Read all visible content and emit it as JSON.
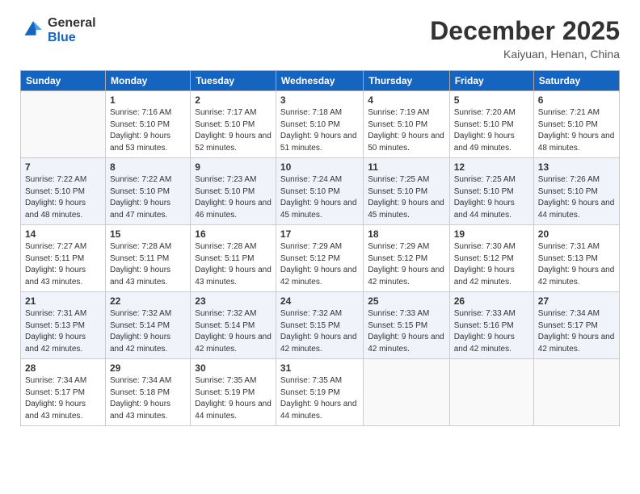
{
  "header": {
    "logo_general": "General",
    "logo_blue": "Blue",
    "month": "December 2025",
    "location": "Kaiyuan, Henan, China"
  },
  "weekdays": [
    "Sunday",
    "Monday",
    "Tuesday",
    "Wednesday",
    "Thursday",
    "Friday",
    "Saturday"
  ],
  "weeks": [
    [
      {
        "day": null
      },
      {
        "day": 1,
        "sunrise": "7:16 AM",
        "sunset": "5:10 PM",
        "daylight": "9 hours and 53 minutes."
      },
      {
        "day": 2,
        "sunrise": "7:17 AM",
        "sunset": "5:10 PM",
        "daylight": "9 hours and 52 minutes."
      },
      {
        "day": 3,
        "sunrise": "7:18 AM",
        "sunset": "5:10 PM",
        "daylight": "9 hours and 51 minutes."
      },
      {
        "day": 4,
        "sunrise": "7:19 AM",
        "sunset": "5:10 PM",
        "daylight": "9 hours and 50 minutes."
      },
      {
        "day": 5,
        "sunrise": "7:20 AM",
        "sunset": "5:10 PM",
        "daylight": "9 hours and 49 minutes."
      },
      {
        "day": 6,
        "sunrise": "7:21 AM",
        "sunset": "5:10 PM",
        "daylight": "9 hours and 48 minutes."
      }
    ],
    [
      {
        "day": 7,
        "sunrise": "7:22 AM",
        "sunset": "5:10 PM",
        "daylight": "9 hours and 48 minutes."
      },
      {
        "day": 8,
        "sunrise": "7:22 AM",
        "sunset": "5:10 PM",
        "daylight": "9 hours and 47 minutes."
      },
      {
        "day": 9,
        "sunrise": "7:23 AM",
        "sunset": "5:10 PM",
        "daylight": "9 hours and 46 minutes."
      },
      {
        "day": 10,
        "sunrise": "7:24 AM",
        "sunset": "5:10 PM",
        "daylight": "9 hours and 45 minutes."
      },
      {
        "day": 11,
        "sunrise": "7:25 AM",
        "sunset": "5:10 PM",
        "daylight": "9 hours and 45 minutes."
      },
      {
        "day": 12,
        "sunrise": "7:25 AM",
        "sunset": "5:10 PM",
        "daylight": "9 hours and 44 minutes."
      },
      {
        "day": 13,
        "sunrise": "7:26 AM",
        "sunset": "5:10 PM",
        "daylight": "9 hours and 44 minutes."
      }
    ],
    [
      {
        "day": 14,
        "sunrise": "7:27 AM",
        "sunset": "5:11 PM",
        "daylight": "9 hours and 43 minutes."
      },
      {
        "day": 15,
        "sunrise": "7:28 AM",
        "sunset": "5:11 PM",
        "daylight": "9 hours and 43 minutes."
      },
      {
        "day": 16,
        "sunrise": "7:28 AM",
        "sunset": "5:11 PM",
        "daylight": "9 hours and 43 minutes."
      },
      {
        "day": 17,
        "sunrise": "7:29 AM",
        "sunset": "5:12 PM",
        "daylight": "9 hours and 42 minutes."
      },
      {
        "day": 18,
        "sunrise": "7:29 AM",
        "sunset": "5:12 PM",
        "daylight": "9 hours and 42 minutes."
      },
      {
        "day": 19,
        "sunrise": "7:30 AM",
        "sunset": "5:12 PM",
        "daylight": "9 hours and 42 minutes."
      },
      {
        "day": 20,
        "sunrise": "7:31 AM",
        "sunset": "5:13 PM",
        "daylight": "9 hours and 42 minutes."
      }
    ],
    [
      {
        "day": 21,
        "sunrise": "7:31 AM",
        "sunset": "5:13 PM",
        "daylight": "9 hours and 42 minutes."
      },
      {
        "day": 22,
        "sunrise": "7:32 AM",
        "sunset": "5:14 PM",
        "daylight": "9 hours and 42 minutes."
      },
      {
        "day": 23,
        "sunrise": "7:32 AM",
        "sunset": "5:14 PM",
        "daylight": "9 hours and 42 minutes."
      },
      {
        "day": 24,
        "sunrise": "7:32 AM",
        "sunset": "5:15 PM",
        "daylight": "9 hours and 42 minutes."
      },
      {
        "day": 25,
        "sunrise": "7:33 AM",
        "sunset": "5:15 PM",
        "daylight": "9 hours and 42 minutes."
      },
      {
        "day": 26,
        "sunrise": "7:33 AM",
        "sunset": "5:16 PM",
        "daylight": "9 hours and 42 minutes."
      },
      {
        "day": 27,
        "sunrise": "7:34 AM",
        "sunset": "5:17 PM",
        "daylight": "9 hours and 42 minutes."
      }
    ],
    [
      {
        "day": 28,
        "sunrise": "7:34 AM",
        "sunset": "5:17 PM",
        "daylight": "9 hours and 43 minutes."
      },
      {
        "day": 29,
        "sunrise": "7:34 AM",
        "sunset": "5:18 PM",
        "daylight": "9 hours and 43 minutes."
      },
      {
        "day": 30,
        "sunrise": "7:35 AM",
        "sunset": "5:19 PM",
        "daylight": "9 hours and 44 minutes."
      },
      {
        "day": 31,
        "sunrise": "7:35 AM",
        "sunset": "5:19 PM",
        "daylight": "9 hours and 44 minutes."
      },
      {
        "day": null
      },
      {
        "day": null
      },
      {
        "day": null
      }
    ]
  ]
}
